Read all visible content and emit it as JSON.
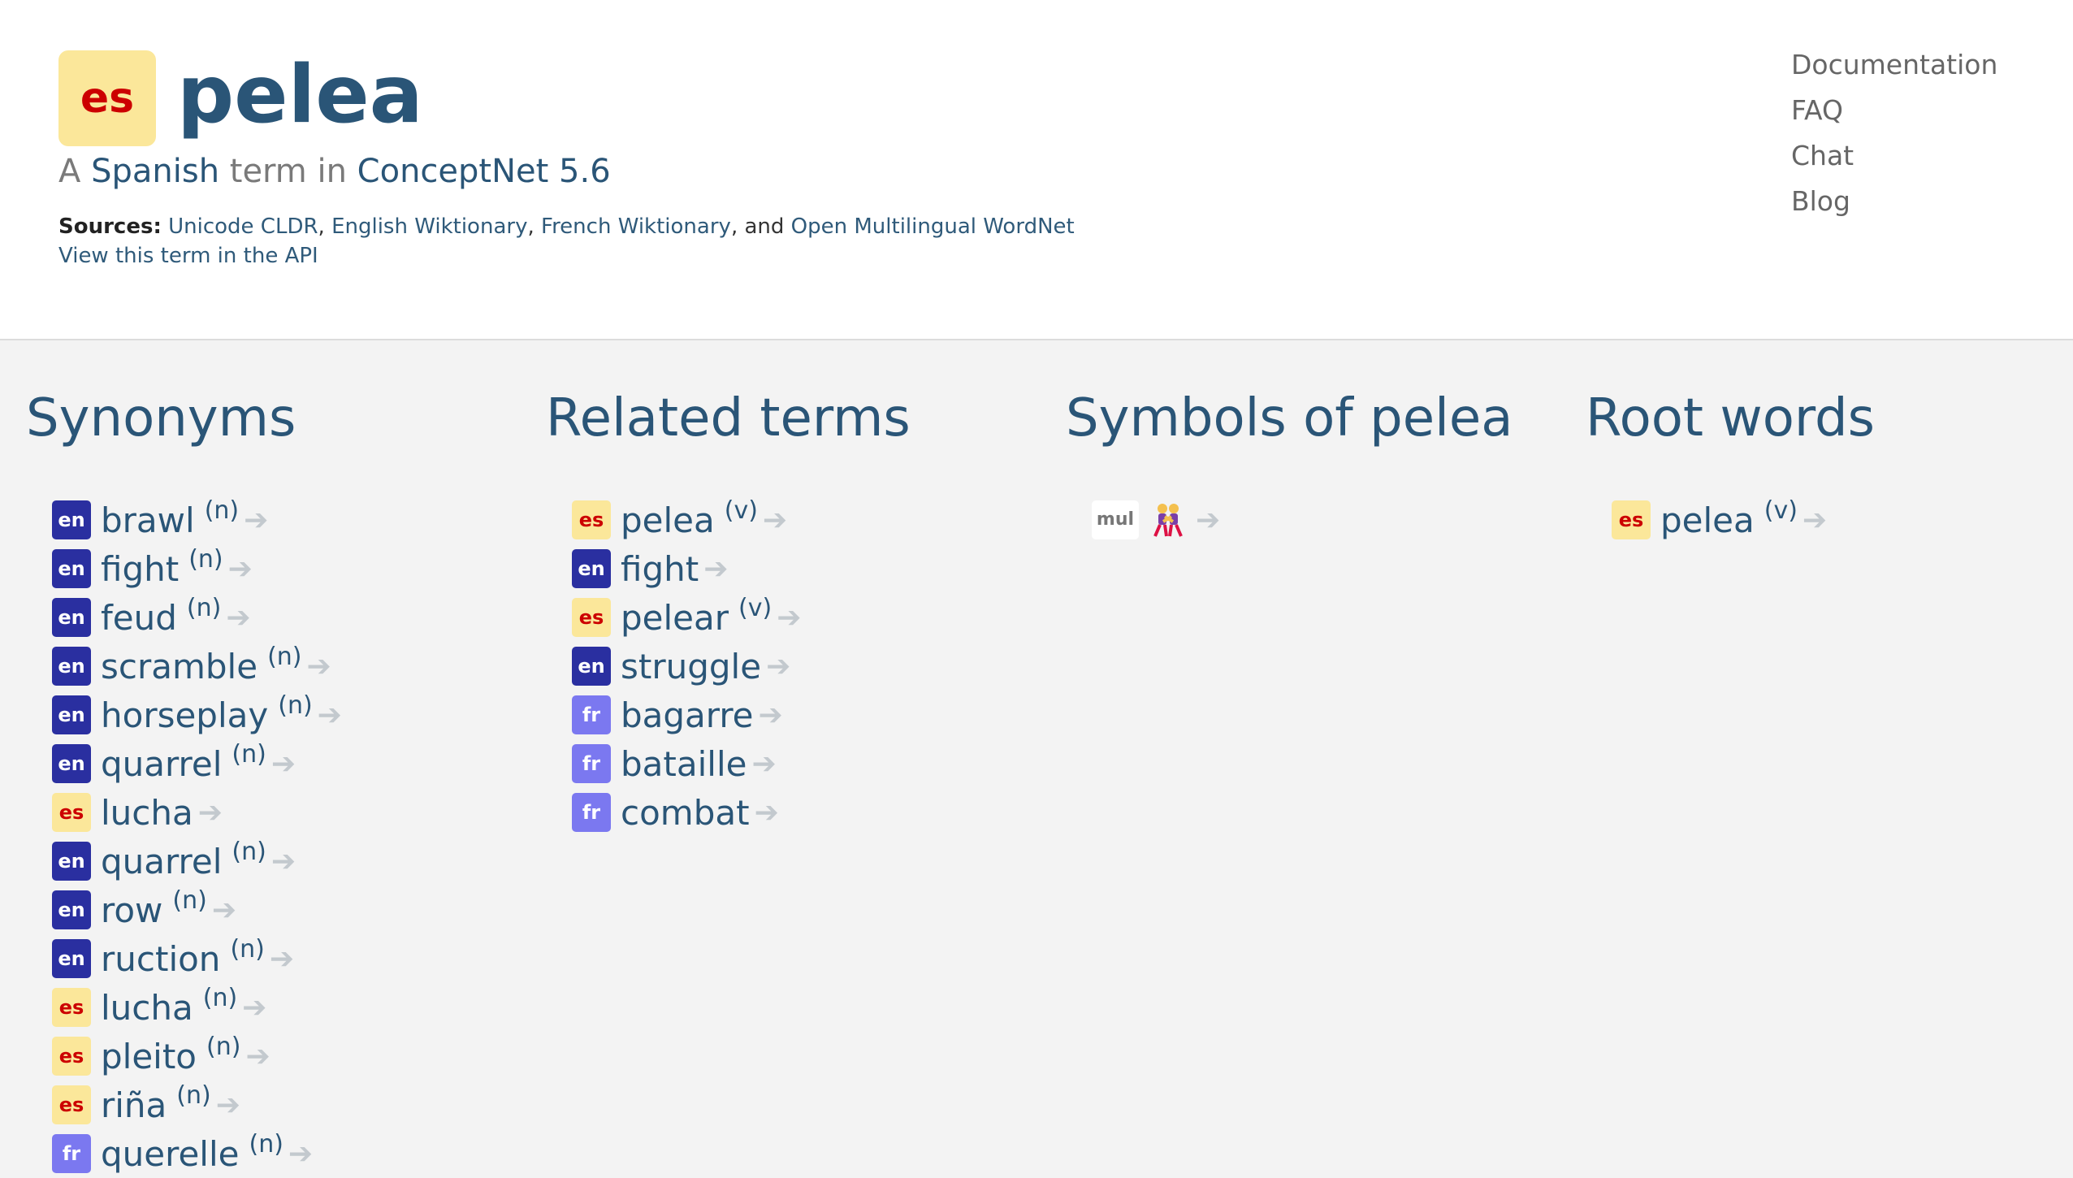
{
  "header": {
    "lang_code": "es",
    "term": "pelea",
    "subtitle_prefix": "A",
    "language_link": "Spanish",
    "subtitle_middle": "term in",
    "conceptnet_link": "ConceptNet 5.6",
    "sources_label": "Sources:",
    "sources": [
      "Unicode CLDR",
      "English Wiktionary",
      "French Wiktionary",
      "Open Multilingual WordNet"
    ],
    "sources_and": ", and",
    "api_link": "View this term in the API"
  },
  "nav": [
    "Documentation",
    "FAQ",
    "Chat",
    "Blog"
  ],
  "columns": {
    "synonyms": {
      "title": "Synonyms",
      "items": [
        {
          "lang": "en",
          "word": "brawl",
          "pos": "(n)"
        },
        {
          "lang": "en",
          "word": "fight",
          "pos": "(n)"
        },
        {
          "lang": "en",
          "word": "feud",
          "pos": "(n)"
        },
        {
          "lang": "en",
          "word": "scramble",
          "pos": "(n)"
        },
        {
          "lang": "en",
          "word": "horseplay",
          "pos": "(n)"
        },
        {
          "lang": "en",
          "word": "quarrel",
          "pos": "(n)"
        },
        {
          "lang": "es",
          "word": "lucha",
          "pos": ""
        },
        {
          "lang": "en",
          "word": "quarrel",
          "pos": "(n)"
        },
        {
          "lang": "en",
          "word": "row",
          "pos": "(n)"
        },
        {
          "lang": "en",
          "word": "ruction",
          "pos": "(n)"
        },
        {
          "lang": "es",
          "word": "lucha",
          "pos": "(n)"
        },
        {
          "lang": "es",
          "word": "pleito",
          "pos": "(n)"
        },
        {
          "lang": "es",
          "word": "riña",
          "pos": "(n)"
        },
        {
          "lang": "fr",
          "word": "querelle",
          "pos": "(n)"
        }
      ]
    },
    "related": {
      "title": "Related terms",
      "items": [
        {
          "lang": "es",
          "word": "pelea",
          "pos": "(v)"
        },
        {
          "lang": "en",
          "word": "fight",
          "pos": ""
        },
        {
          "lang": "es",
          "word": "pelear",
          "pos": "(v)"
        },
        {
          "lang": "en",
          "word": "struggle",
          "pos": ""
        },
        {
          "lang": "fr",
          "word": "bagarre",
          "pos": ""
        },
        {
          "lang": "fr",
          "word": "bataille",
          "pos": ""
        },
        {
          "lang": "fr",
          "word": "combat",
          "pos": ""
        }
      ]
    },
    "symbols": {
      "title": "Symbols of pelea",
      "items": [
        {
          "lang": "mul",
          "symbol": "wrestlers-emoji"
        }
      ]
    },
    "root": {
      "title": "Root words",
      "items": [
        {
          "lang": "es",
          "word": "pelea",
          "pos": "(v)"
        }
      ]
    }
  },
  "arrow": "➔",
  "colors": {
    "en": "#2a2fa0",
    "es": "#fbe79a",
    "es_text": "#cc0000",
    "fr": "#7b78f0",
    "link": "#2a5577"
  }
}
